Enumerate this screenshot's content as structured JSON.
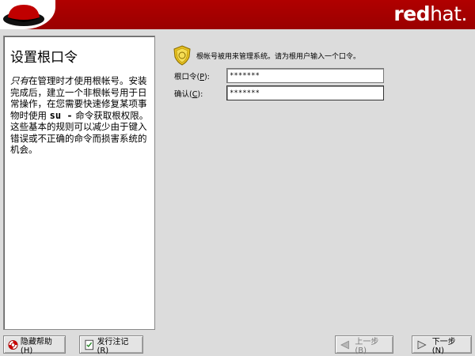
{
  "header": {
    "logo_bold": "red",
    "logo_light": "hat."
  },
  "help": {
    "title": "设置根口令",
    "text_italic": "只有",
    "text_part1": "在管理时才使用根帐号。安装完成后，建立一个非根帐号用于日常操作，在您需要快速修复某项事物时使用 ",
    "command": "su -",
    "text_part2": " 命令获取根权限。这些基本的规则可以减少由于键入错误或不正确的命令而损害系统的机会。"
  },
  "main": {
    "info": "根帐号被用来管理系统。请为根用户输入一个口令。",
    "password_label": "根口令(",
    "password_key": "P",
    "password_label_end": "):",
    "password_value": "*******",
    "confirm_label": "确认(",
    "confirm_key": "C",
    "confirm_label_end": "):",
    "confirm_value": "*******"
  },
  "buttons": {
    "hide_help": "隐藏帮助(H)",
    "release_notes": "发行注记(R)",
    "back": "上一步(B)",
    "next": "下一步(N)"
  },
  "colors": {
    "banner": "#a30000",
    "background": "#dcdcdc"
  }
}
